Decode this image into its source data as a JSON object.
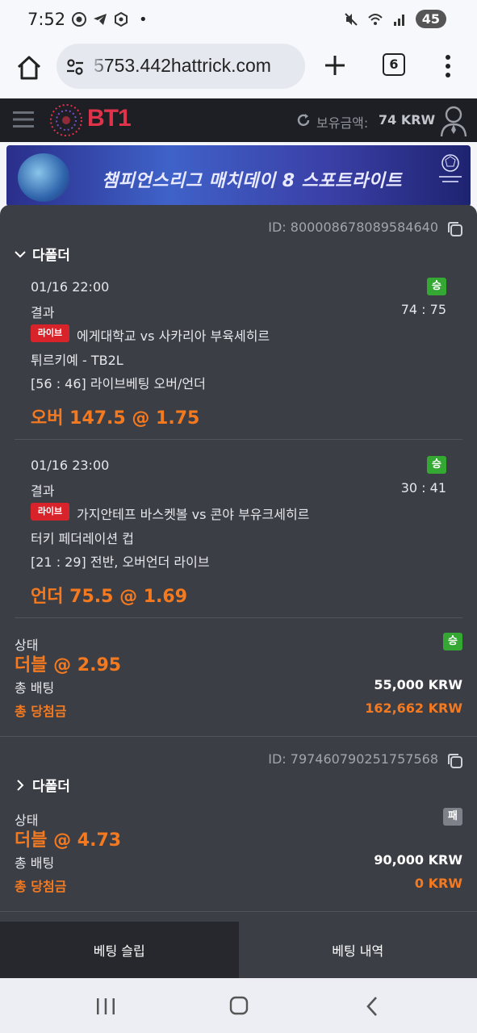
{
  "status_bar": {
    "time": "7:52",
    "dot": "•",
    "battery": "45"
  },
  "browser": {
    "url": "5753.442hattrick.com",
    "tab_count": "6"
  },
  "site": {
    "logo": "BT1",
    "balance_label": "보유금액:",
    "balance_value": "74 KRW"
  },
  "banner": {
    "text": "챔피언스리그 매치데이 8 스포트라이트"
  },
  "tickets": [
    {
      "id": "ID: 800008678089584640",
      "section_label": "다폴더",
      "expanded": true,
      "bets": [
        {
          "date": "01/16 22:00",
          "badge": "승",
          "result_label": "결과",
          "score": "74 : 75",
          "live_label": "라이브",
          "match": "에게대학교 vs 사카리아 부육세히르",
          "league": "튀르키예 - TB2L",
          "market": "[56 : 46] 라이브베팅 오버/언더",
          "pick": "오버 147.5 @ 1.75"
        },
        {
          "date": "01/16 23:00",
          "badge": "승",
          "result_label": "결과",
          "score": "30 : 41",
          "live_label": "라이브",
          "match": "가지안테프 바스켓볼 vs 콘야 부유크세히르",
          "league": "터키 페더레이션 컵",
          "market": "[21 : 29] 전반, 오버언더 라이브",
          "pick": "언더 75.5 @ 1.69"
        }
      ],
      "summary": {
        "status_label": "상태",
        "status_badge": "승",
        "status_color": "#35a833",
        "total_odds": "더블 @ 2.95",
        "bet_label": "총 배팅",
        "bet_value": "55,000 KRW",
        "win_label": "총 당첨금",
        "win_value": "162,662 KRW"
      }
    },
    {
      "id": "ID: 797460790251757568",
      "section_label": "다폴더",
      "expanded": false,
      "summary": {
        "status_label": "상태",
        "status_badge": "패",
        "status_color": "#7e818a",
        "total_odds": "더블 @ 4.73",
        "bet_label": "총 배팅",
        "bet_value": "90,000 KRW",
        "win_label": "총 당첨금",
        "win_value": "0 KRW"
      }
    }
  ],
  "bottom_tabs": {
    "slip": "베팅 슬립",
    "history": "베팅 내역"
  },
  "colors": {
    "accent_orange": "#f57a1f",
    "win_green": "#35a833",
    "live_red": "#d8232a",
    "sheet_bg": "#3c3e46"
  }
}
